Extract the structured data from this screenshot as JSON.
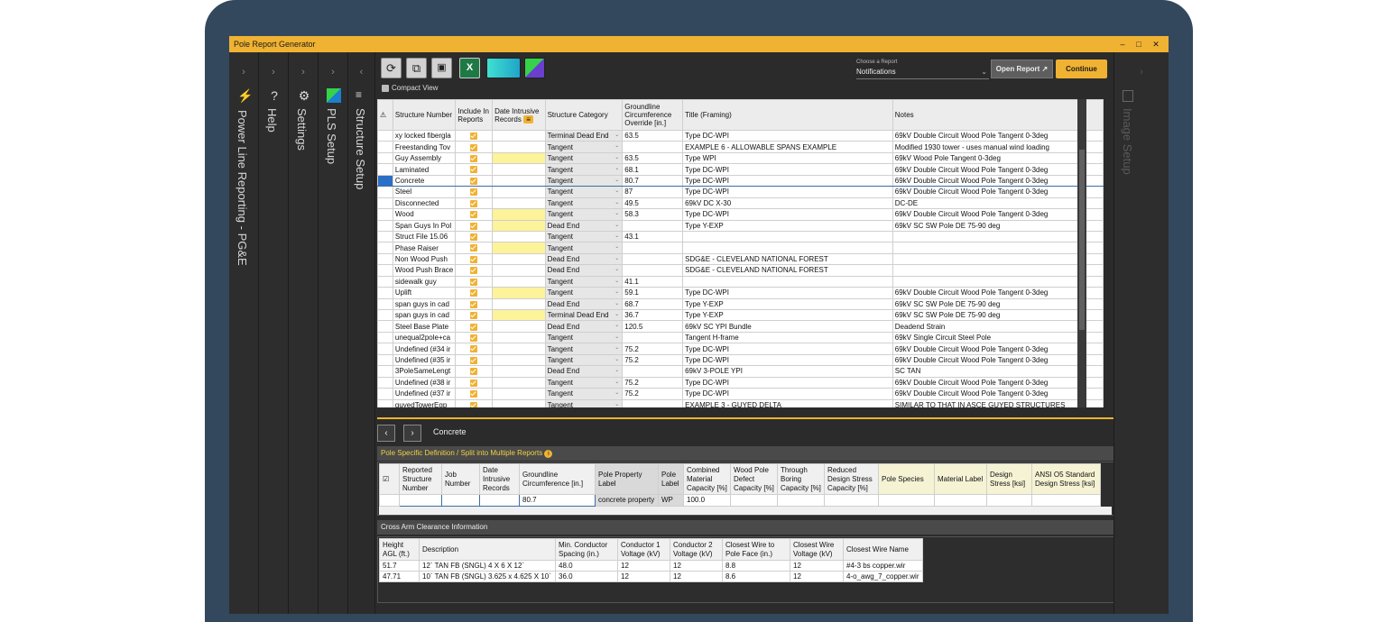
{
  "window": {
    "title": "Pole Report Generator",
    "min": "–",
    "max": "□",
    "close": "✕"
  },
  "sidebar": [
    {
      "chev": "›",
      "label": "Power Line Reporting  -  PG&E",
      "icon": "lightning-icon"
    },
    {
      "chev": "›",
      "label": "Help",
      "icon": "help-icon",
      "glyph": "?"
    },
    {
      "chev": "›",
      "label": "Settings",
      "icon": "gear-icon",
      "glyph": "⚙"
    },
    {
      "chev": "›",
      "label": "PLS Setup",
      "icon": "pls-icon"
    },
    {
      "chev": "‹",
      "label": "Structure Setup",
      "icon": "checklist-icon",
      "glyph": "≡"
    }
  ],
  "toolbar": {
    "refresh": "⟳",
    "copy": "⧉",
    "paste": "📋",
    "excel": "X"
  },
  "report": {
    "choose_label": "Choose a Report",
    "selected": "Notifications",
    "open_label": "Open Report",
    "continue_label": "Continue"
  },
  "compact_view": "Compact View",
  "grid": {
    "headers": [
      "Structure Number",
      "Include In Reports",
      "Date Intrusive Records",
      "Structure Category",
      "Groundline Circumference Override [in.]",
      "Title (Framing)",
      "Notes"
    ],
    "rows": [
      [
        "xy locked fibergla",
        "",
        "Terminal Dead End",
        "63.5",
        "Type DC-WPI",
        "69kV Double Circuit Wood Pole Tangent 0-3deg"
      ],
      [
        "Freestanding Tov",
        "",
        "Tangent",
        "",
        "EXAMPLE 6 - ALLOWABLE SPANS EXAMPLE",
        "Modified 1930 tower - uses manual wind loading"
      ],
      [
        "Guy Assembly",
        "y",
        "Tangent",
        "63.5",
        "Type WPI",
        "69kV Wood Pole Tangent 0-3deg"
      ],
      [
        "Laminated",
        "",
        "Tangent",
        "68.1",
        "Type DC-WPI",
        "69kV Double Circuit Wood Pole Tangent 0-3deg"
      ],
      [
        "Concrete",
        "",
        "Tangent",
        "80.7",
        "Type DC-WPI",
        "69kV Double Circuit Wood Pole Tangent 0-3deg"
      ],
      [
        "Steel",
        "",
        "Tangent",
        "87",
        "Type DC-WPI",
        "69kV Double Circuit Wood Pole Tangent 0-3deg"
      ],
      [
        "Disconnected",
        "",
        "Tangent",
        "49.5",
        "69kV DC X-30",
        "DC-DE"
      ],
      [
        "Wood",
        "y",
        "Tangent",
        "58.3",
        "Type DC-WPI",
        "69kV Double Circuit Wood Pole Tangent 0-3deg"
      ],
      [
        "Span Guys In Pol",
        "y",
        "Dead End",
        "",
        "Type Y-EXP",
        "69kV SC SW Pole DE 75-90 deg"
      ],
      [
        "Struct File 15.06",
        "",
        "Tangent",
        "43.1",
        "",
        ""
      ],
      [
        "Phase Raiser",
        "y",
        "Tangent",
        "",
        "",
        ""
      ],
      [
        "Non Wood Push",
        "",
        "Dead End",
        "",
        "SDG&E - CLEVELAND NATIONAL FOREST",
        ""
      ],
      [
        "Wood Push Brace",
        "",
        "Dead End",
        "",
        "SDG&E - CLEVELAND NATIONAL FOREST",
        ""
      ],
      [
        "sidewalk guy",
        "",
        "Tangent",
        "41.1",
        "",
        ""
      ],
      [
        "Uplift",
        "y",
        "Tangent",
        "59.1",
        "Type DC-WPI",
        "69kV Double Circuit Wood Pole Tangent 0-3deg"
      ],
      [
        "span guys in cad",
        "",
        "Dead End",
        "68.7",
        "Type Y-EXP",
        "69kV SC SW Pole DE 75-90 deg"
      ],
      [
        "span guys in cad",
        "y",
        "Terminal Dead End",
        "36.7",
        "Type Y-EXP",
        "69kV SC SW Pole DE 75-90 deg"
      ],
      [
        "Steel Base Plate",
        "",
        "Dead End",
        "120.5",
        "69kV SC YPI Bundle",
        "Deadend Strain"
      ],
      [
        "unequal2pole+ca",
        "",
        "Tangent",
        "",
        "Tangent H-frame",
        "69kV Single Circuit Steel Pole"
      ],
      [
        "Undefined (#34 ir",
        "",
        "Tangent",
        "75.2",
        "Type DC-WPI",
        "69kV Double Circuit Wood Pole Tangent 0-3deg"
      ],
      [
        "Undefined (#35 ir",
        "",
        "Tangent",
        "75.2",
        "Type DC-WPI",
        "69kV Double Circuit Wood Pole Tangent 0-3deg"
      ],
      [
        "3PoleSameLengt",
        "",
        "Dead End",
        "",
        "69kV  3-POLE YPI",
        "SC TAN"
      ],
      [
        "Undefined (#38 ir",
        "",
        "Tangent",
        "75.2",
        "Type DC-WPI",
        "69kV Double Circuit Wood Pole Tangent 0-3deg"
      ],
      [
        "Undefined (#37 ir",
        "",
        "Tangent",
        "75.2",
        "Type DC-WPI",
        "69kV Double Circuit Wood Pole Tangent 0-3deg"
      ],
      [
        "guyedTowerEgp",
        "",
        "Tangent",
        "",
        "EXAMPLE 3 -  GUYED DELTA",
        "SIMILAR TO THAT IN ASCE GUYED STRUCTURES"
      ]
    ]
  },
  "nav": {
    "prev": "‹",
    "next": "›",
    "title": "Concrete"
  },
  "pole_def": {
    "title": "Pole Specific Definition / Split into Multiple Reports",
    "headers": [
      "Reported Structure Number",
      "Job Number",
      "Date Intrusive Records",
      "Groundline Circumference [in.]",
      "Pole Property Label",
      "Pole Label",
      "Combined Material Capacity [%]",
      "Wood Pole Defect Capacity [%]",
      "Through Boring Capacity [%]",
      "Reduced Design Stress Capacity [%]",
      "Pole Species",
      "Material Label",
      "Design Stress [ksi]",
      "ANSI O5 Standard Design Stress [ksi]"
    ],
    "row": [
      "",
      "",
      "",
      "80.7",
      "concrete property",
      "WP",
      "100.0",
      "",
      "",
      "",
      "",
      "",
      "",
      ""
    ]
  },
  "crossarm": {
    "title": "Cross Arm Clearance Information",
    "headers": [
      "Height AGL (ft.)",
      "Description",
      "Min. Conductor Spacing (in.)",
      "Conductor 1 Voltage (kV)",
      "Conductor 2 Voltage (kV)",
      "Closest Wire to Pole Face (in.)",
      "Closest Wire Voltage (kV)",
      "Closest Wire Name"
    ],
    "rows": [
      [
        "51.7",
        "12` TAN FB (SNGL) 4 X 6 X 12`",
        "48.0",
        "12",
        "12",
        "8.8",
        "12",
        "#4-3 bs copper.wir"
      ],
      [
        "47.71",
        "10` TAN FB (SNGL) 3.625 x 4.625 X 10`",
        "36.0",
        "12",
        "12",
        "8.6",
        "12",
        "4-o_awg_7_copper.wir"
      ]
    ]
  },
  "image_setup": "Image Setup",
  "colors": {
    "accent": "#f0b232",
    "frame": "#33485c"
  }
}
